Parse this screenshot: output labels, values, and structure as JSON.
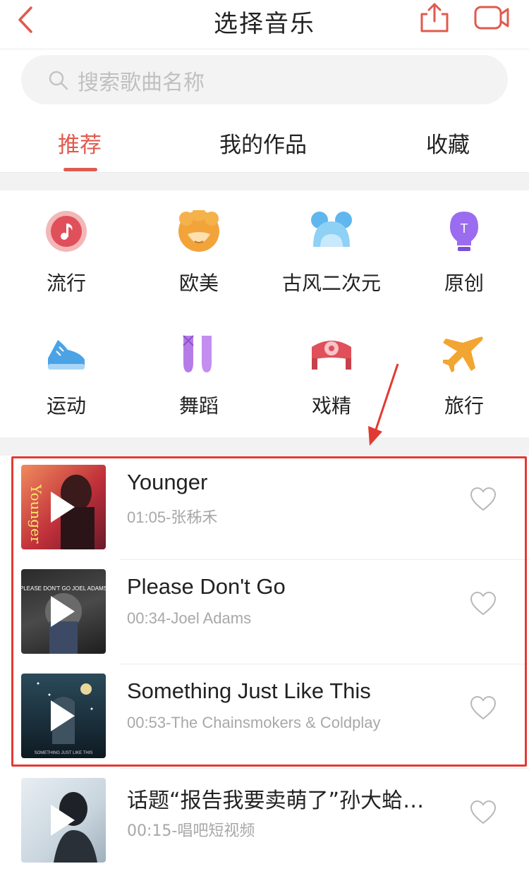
{
  "header": {
    "title": "选择音乐",
    "back_icon": "chevron-left-icon",
    "share_icon": "share-upload-icon",
    "video_icon": "video-camera-icon"
  },
  "search": {
    "placeholder": "搜索歌曲名称",
    "icon": "search-icon"
  },
  "tabs": [
    {
      "label": "推荐",
      "active": true
    },
    {
      "label": "我的作品",
      "active": false
    },
    {
      "label": "收藏",
      "active": false
    }
  ],
  "categories": [
    {
      "label": "流行",
      "icon": "music-note-icon"
    },
    {
      "label": "欧美",
      "icon": "curly-hair-face-icon"
    },
    {
      "label": "古风二次元",
      "icon": "mouse-ears-icon"
    },
    {
      "label": "原创",
      "icon": "light-bulb-icon"
    },
    {
      "label": "运动",
      "icon": "sneaker-icon"
    },
    {
      "label": "舞蹈",
      "icon": "ballet-shoes-icon"
    },
    {
      "label": "戏精",
      "icon": "opera-headdress-icon"
    },
    {
      "label": "旅行",
      "icon": "airplane-icon"
    }
  ],
  "songs": [
    {
      "title": "Younger",
      "meta": "01:05-张秭禾",
      "cover_caption": "Younger"
    },
    {
      "title": "Please Don't Go",
      "meta": "00:34-Joel Adams",
      "cover_caption": "PLEASE DON'T GO JOEL ADAMS"
    },
    {
      "title": "Something Just Like This",
      "meta": "00:53-The Chainsmokers & Coldplay",
      "cover_caption": "SOMETHING JUST LIKE THIS"
    },
    {
      "title": "话题“报告我要卖萌了”孙大蛤…",
      "meta": "00:15-唱吧短视频",
      "cover_caption": ""
    }
  ],
  "colors": {
    "accent": "#e05a4e",
    "highlight_box": "#e23a33"
  }
}
